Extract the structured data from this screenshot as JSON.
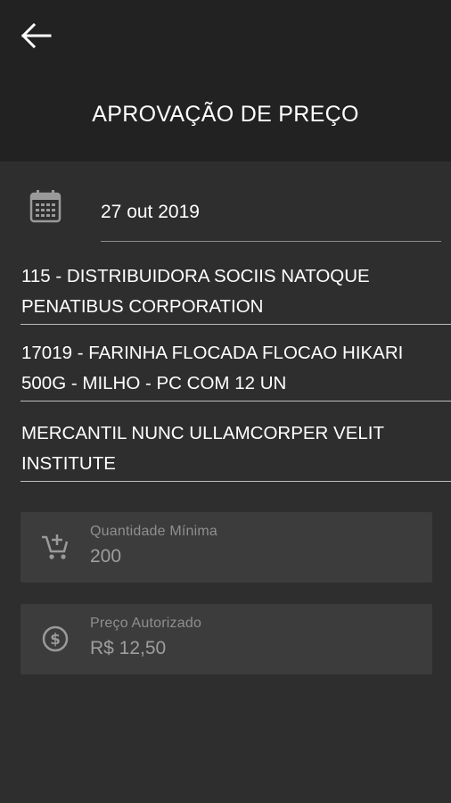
{
  "header": {
    "title": "APROVAÇÃO DE PREÇO",
    "back_icon": "arrow-left-icon"
  },
  "date": {
    "icon": "calendar-icon",
    "value": "27 out 2019"
  },
  "distributor": {
    "line1": "115 - DISTRIBUIDORA SOCIIS NATOQUE",
    "line2": "PENATIBUS CORPORATION"
  },
  "product": {
    "line1": "17019 - FARINHA FLOCADA FLOCAO HIKARI",
    "line2": "500G - MILHO - PC COM 12 UN"
  },
  "store": {
    "line1": "MERCANTIL NUNC ULLAMCORPER VELIT",
    "line2": "INSTITUTE"
  },
  "min_quantity": {
    "icon": "add-shopping-cart-icon",
    "label": "Quantidade Mínima",
    "value": "200"
  },
  "authorized_price": {
    "icon": "dollar-circle-icon",
    "label": "Preço Autorizado",
    "value": "R$ 12,50"
  },
  "colors": {
    "header_bg": "#222222",
    "page_bg": "#2e2e2e",
    "field_bg": "#3c3c3c",
    "label_gray": "#8f8f8f"
  }
}
